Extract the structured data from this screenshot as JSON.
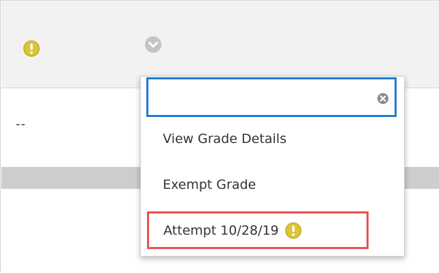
{
  "grid": {
    "header": {
      "status_icon": "exclamation-circle-icon",
      "menu_toggle_icon": "chevron-down-icon"
    },
    "cell": {
      "value": "--"
    }
  },
  "menu": {
    "search": {
      "value": "",
      "placeholder": "",
      "clear_icon": "clear-icon"
    },
    "items": [
      {
        "label": "View Grade Details"
      },
      {
        "label": "Exempt Grade"
      },
      {
        "label": "Attempt 10/28/19",
        "icon": "exclamation-circle-icon",
        "highlighted": true
      }
    ]
  },
  "colors": {
    "header_bg": "#f2f2f2",
    "band_bg": "#cdcdcd",
    "focus_border": "#1d7bd1",
    "highlight_border": "#e8504f",
    "alert_icon": "#c9b42c",
    "text": "#333333"
  }
}
